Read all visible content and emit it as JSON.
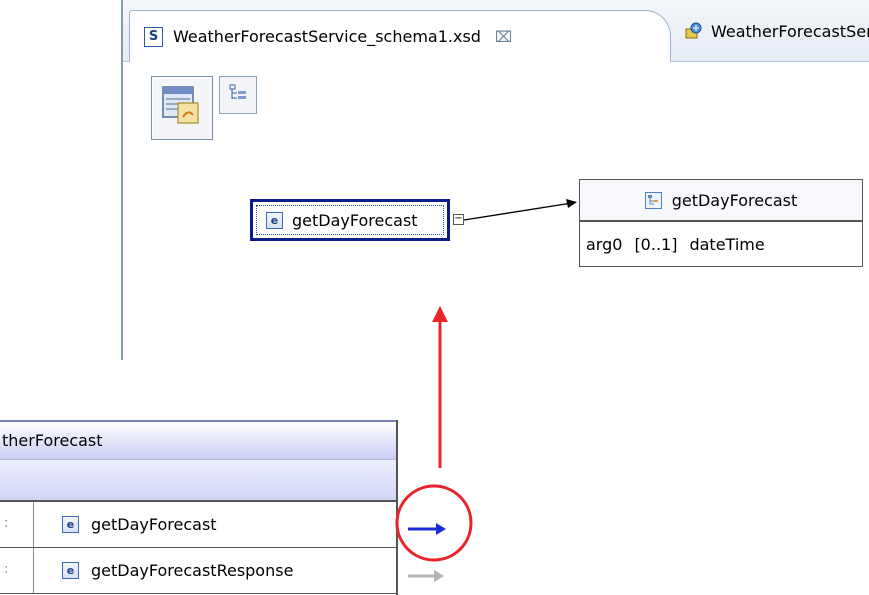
{
  "tabs": [
    {
      "label": "WeatherForecastService_schema1.xsd",
      "icon": "schema-s-icon",
      "close": "⌧",
      "active": true
    },
    {
      "label": "WeatherForecastSer",
      "icon": "web-service-icon",
      "active": false
    }
  ],
  "toolbar": {
    "design_view_icon": "design-view-icon",
    "outline_icon": "tree-outline-icon"
  },
  "canvas": {
    "element_node": {
      "icon_letter": "e",
      "label": "getDayForecast",
      "expander": "−"
    },
    "type_box": {
      "title": "getDayForecast",
      "row": {
        "name": "arg0",
        "multiplicity": "[0..1]",
        "type": "dateTime"
      }
    }
  },
  "list": {
    "title": "therForecast",
    "rows": [
      {
        "icon_letter": "e",
        "label": "getDayForecast",
        "col_mark": ":"
      },
      {
        "icon_letter": "e",
        "label": "getDayForecastResponse",
        "col_mark": ":"
      }
    ]
  },
  "colors": {
    "highlight_red": "#e8232a",
    "active_arrow_blue": "#1b2bd8",
    "inactive_arrow_gray": "#b5b5b5",
    "node_border": "#0a1c8a"
  }
}
